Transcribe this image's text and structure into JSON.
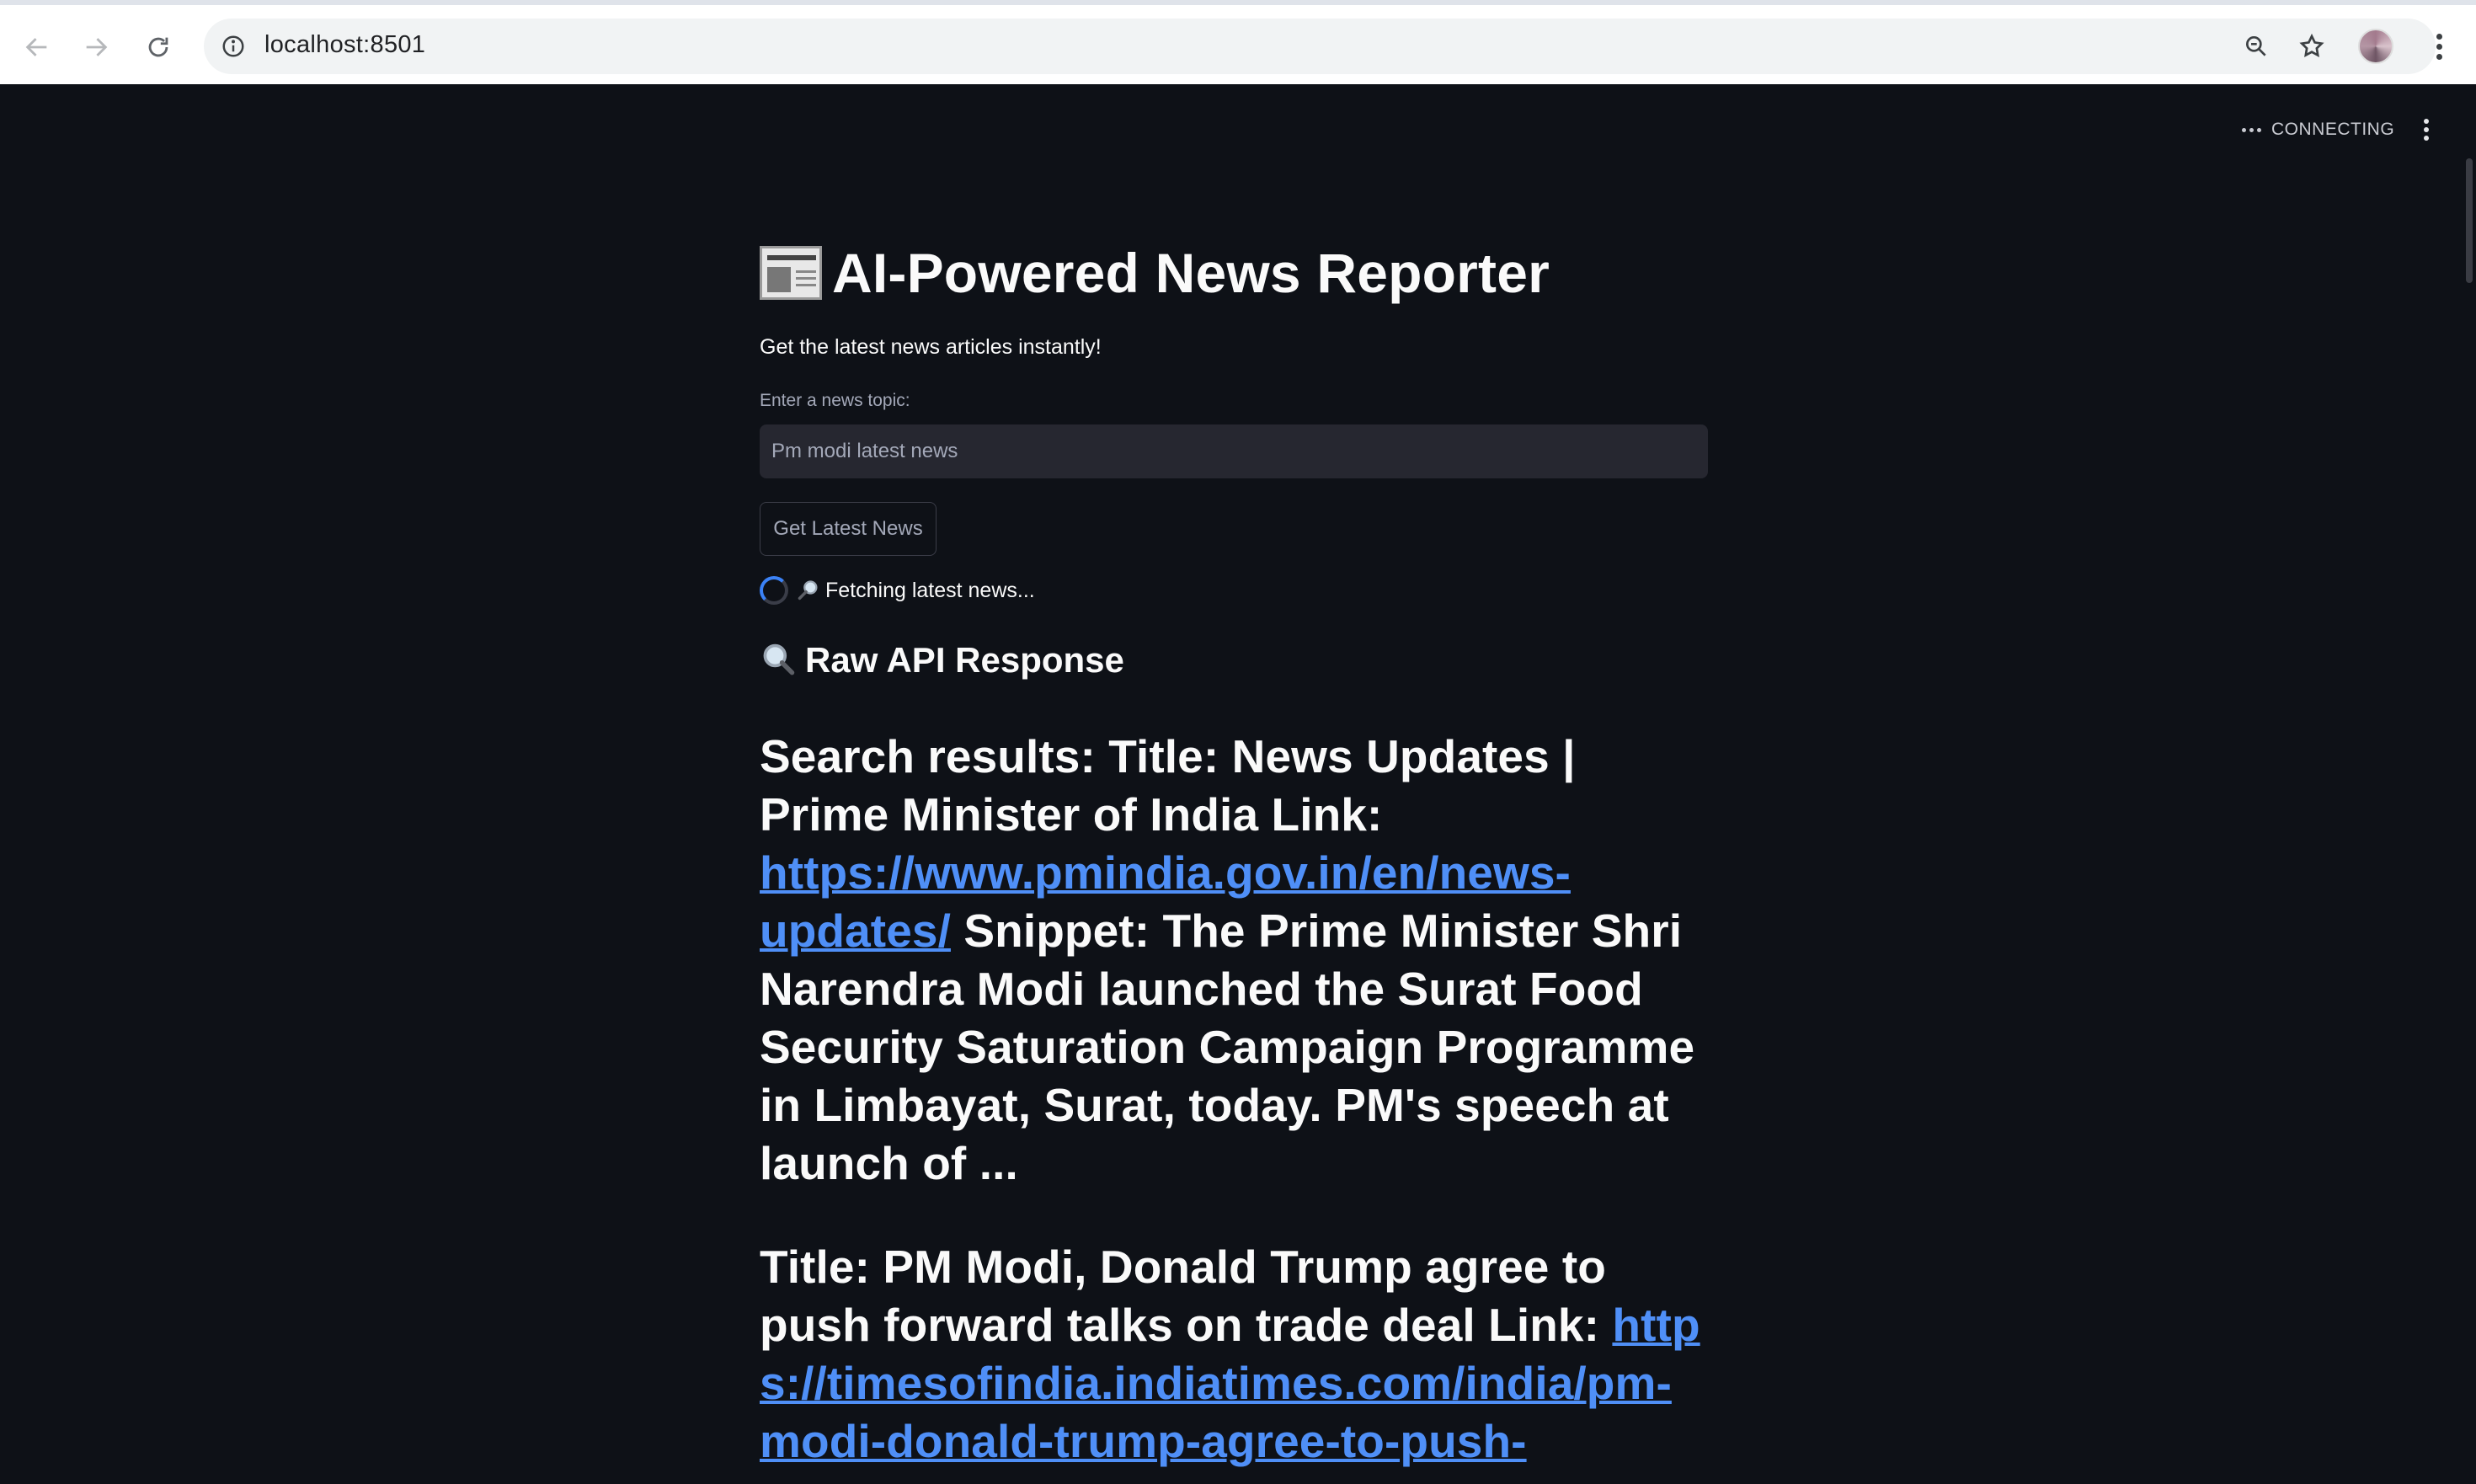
{
  "browser": {
    "url": "localhost:8501"
  },
  "app": {
    "status_text": "CONNECTING",
    "title": "AI-Powered News Reporter",
    "title_icon": "newspaper-icon",
    "subtitle": "Get the latest news articles instantly!",
    "input_label": "Enter a news topic:",
    "input_value": "Pm modi latest news",
    "button_label": "Get Latest News",
    "spinner_text": "Fetching latest news...",
    "spinner_icon": "magnifier-right-icon",
    "raw_heading": "Raw API Response",
    "raw_heading_icon": "magnifier-left-icon",
    "link_color": "#4f8ff7",
    "background_color": "#0e1117"
  },
  "results": [
    {
      "prefix": "Search results: Title: News Updates | Prime Minister of India Link:",
      "link": "https://www.pmindia.gov.in/en/news-updates/",
      "snippet": "Snippet: The Prime Minister Shri Narendra Modi launched the Surat Food Security Saturation Campaign Programme in Limbayat, Surat, today. PM's speech at launch of ..."
    },
    {
      "prefix": "Title: PM Modi, Donald Trump agree to push forward talks on trade deal Link:",
      "link": "https://timesofindia.indiatimes.com/india/pm-modi-donald-trump-agree-to-push-"
    }
  ]
}
